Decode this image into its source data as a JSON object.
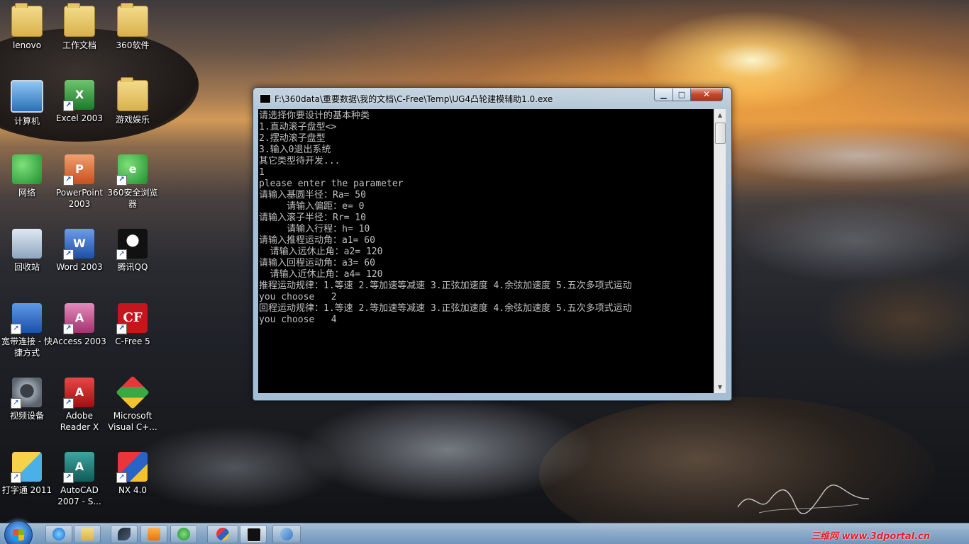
{
  "desktop_icons": [
    {
      "label": "lenovo",
      "icon": "user-folder-icon"
    },
    {
      "label": "工作文档",
      "icon": "folder-icon"
    },
    {
      "label": "360软件",
      "icon": "folder-icon"
    },
    {
      "label": "计算机",
      "icon": "computer-icon"
    },
    {
      "label": "Excel 2003",
      "icon": "excel-icon"
    },
    {
      "label": "游戏娱乐",
      "icon": "folder-icon"
    },
    {
      "label": "网络",
      "icon": "network-icon"
    },
    {
      "label": "PowerPoint 2003",
      "icon": "powerpoint-icon"
    },
    {
      "label": "360安全浏览器",
      "icon": "360-browser-icon"
    },
    {
      "label": "回收站",
      "icon": "recycle-bin-icon"
    },
    {
      "label": "Word 2003",
      "icon": "word-icon"
    },
    {
      "label": "腾讯QQ",
      "icon": "qq-penguin-icon"
    },
    {
      "label": "宽带连接 - 快捷方式",
      "icon": "broadband-connection-icon"
    },
    {
      "label": "Access 2003",
      "icon": "access-icon"
    },
    {
      "label": "C-Free 5",
      "icon": "cfree-icon"
    },
    {
      "label": "视频设备",
      "icon": "webcam-icon"
    },
    {
      "label": "Adobe Reader X",
      "icon": "adobe-reader-icon"
    },
    {
      "label": "Microsoft Visual C+...",
      "icon": "visual-cpp-icon"
    },
    {
      "label": "打字通 2011",
      "icon": "typing-abc-icon"
    },
    {
      "label": "AutoCAD 2007 - S...",
      "icon": "autocad-icon"
    },
    {
      "label": "NX 4.0",
      "icon": "nx-icon"
    }
  ],
  "console": {
    "title": "F:\\360data\\重要数据\\我的文档\\C-Free\\Temp\\UG4凸轮建模辅助1.0.exe",
    "buttons": {
      "minimize": "▁",
      "maximize": "□",
      "close": "✕"
    },
    "lines": [
      "请选择你要设计的基本种类",
      "1.直动滚子盘型<>",
      "2.摆动滚子盘型",
      "3.输入0退出系统",
      "其它类型待开发...",
      "1",
      "please enter the parameter",
      "请输入基圆半径：Ra= 50",
      "     请输入偏距：e= 0",
      "请输入滚子半径：Rr= 10",
      "     请输入行程：h= 10",
      "请输入推程运动角：a1= 60",
      "  请输入远休止角：a2= 120",
      "请输入回程运动角：a3= 60",
      "  请输入近休止角：a4= 120",
      "推程运动规律：1.等速 2.等加速等减速 3.正弦加速度 4.余弦加速度 5.五次多项式运动",
      "you choose   2",
      "回程运动规律：1.等速 2.等加速等减速 3.正弦加速度 4.余弦加速度 5.五次多项式运动",
      "you choose   4"
    ],
    "scroll_up": "▲",
    "scroll_down": "▼"
  },
  "taskbar": {
    "items": [
      {
        "icon": "internet-explorer-icon"
      },
      {
        "icon": "file-explorer-icon"
      },
      {
        "icon": "bird-app-icon"
      },
      {
        "icon": "media-player-icon"
      },
      {
        "icon": "360-browser-icon"
      },
      {
        "icon": "nx-icon"
      },
      {
        "icon": "console-window-icon"
      },
      {
        "icon": "paint-icon"
      }
    ]
  },
  "watermark": "三维网 www.3dportal.cn",
  "colors": {
    "console_bg": "#000000",
    "console_text": "#c0c0c0",
    "close_button": "#c4462b",
    "watermark": "#e0202a"
  }
}
